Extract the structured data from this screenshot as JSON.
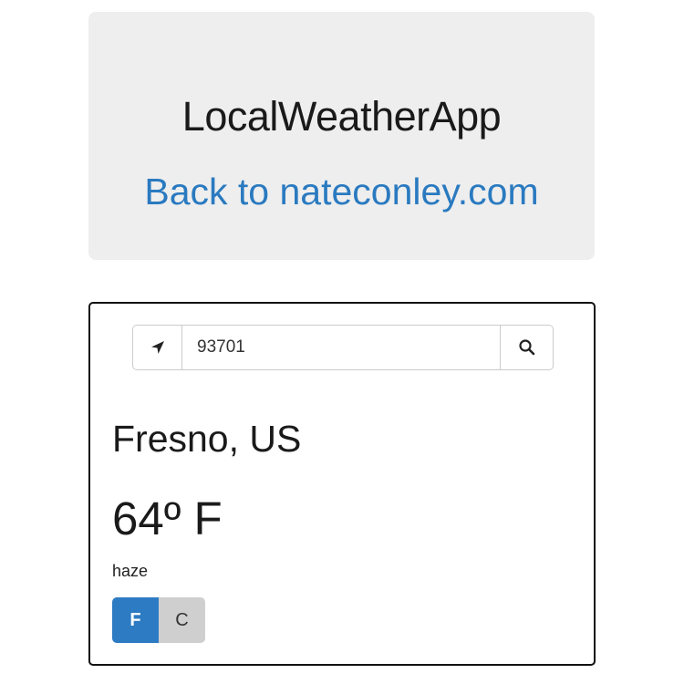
{
  "header": {
    "title": "LocalWeatherApp",
    "back_link": "Back to nateconley.com"
  },
  "search": {
    "zip_value": "93701",
    "location_icon": "location-arrow-icon",
    "search_icon": "search-icon"
  },
  "weather": {
    "location": "Fresno, US",
    "temperature": "64º F",
    "condition": "haze"
  },
  "units": {
    "fahrenheit_label": "F",
    "celsius_label": "C",
    "selected": "F"
  },
  "colors": {
    "link": "#2a7ac0",
    "active_button": "#2d7bc3",
    "inactive_button": "#cfcfcf",
    "jumbotron_bg": "#eeeeee"
  }
}
